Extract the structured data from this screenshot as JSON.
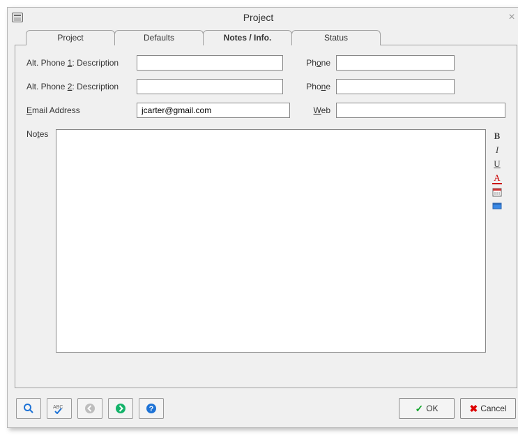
{
  "title": "Project",
  "tabs": [
    {
      "label": "Project",
      "active": false
    },
    {
      "label": "Defaults",
      "active": false
    },
    {
      "label": "Notes / Info.",
      "active": true
    },
    {
      "label": "Status",
      "active": false
    }
  ],
  "fields": {
    "alt_phone1_desc": {
      "label_prefix": "Alt. Phone ",
      "label_num": "1",
      "label_suffix": ": Description",
      "value": ""
    },
    "alt_phone1_num": {
      "label_prefix": "Ph",
      "label_ul": "o",
      "label_suffix": "ne",
      "value": ""
    },
    "alt_phone2_desc": {
      "label_prefix": "Alt. Phone ",
      "label_num": "2",
      "label_suffix": ":  Description",
      "value": ""
    },
    "alt_phone2_num": {
      "label_prefix": "Pho",
      "label_ul": "n",
      "label_suffix": "e",
      "value": ""
    },
    "email": {
      "label_prefix": "",
      "label_ul": "E",
      "label_suffix": "mail Address",
      "value": "jcarter@gmail.com"
    },
    "web": {
      "label_prefix": "",
      "label_ul": "W",
      "label_suffix": "eb",
      "value": ""
    },
    "notes": {
      "label_prefix": "No",
      "label_ul": "t",
      "label_suffix": "es",
      "value": ""
    }
  },
  "note_tools": {
    "bold": "B",
    "italic": "I",
    "underline": "U",
    "font_color": "A"
  },
  "buttons": {
    "ok": "OK",
    "cancel": "Cancel"
  }
}
